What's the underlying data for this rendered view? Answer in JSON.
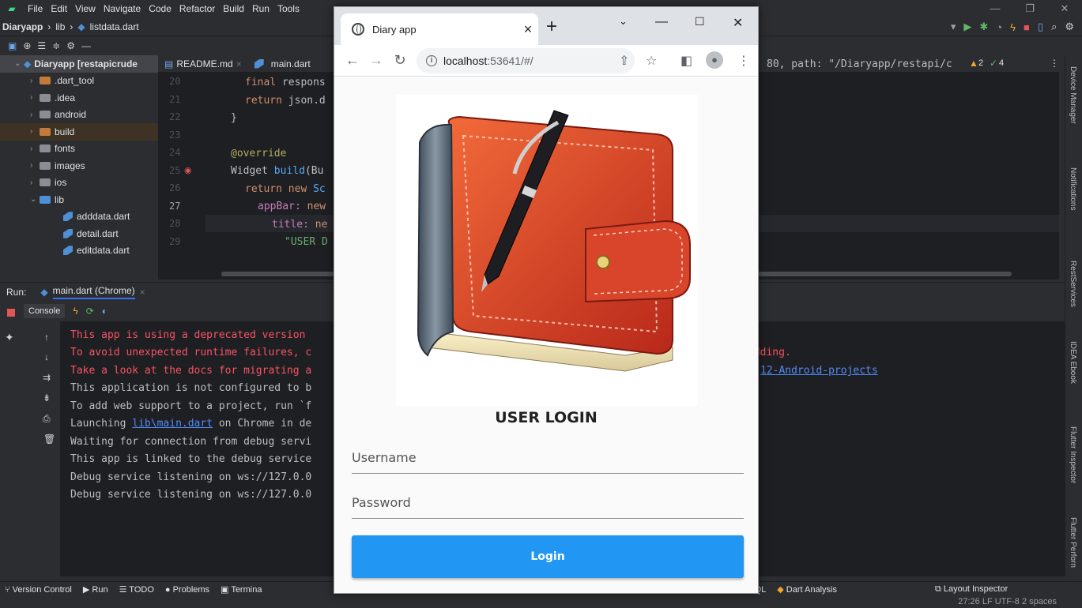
{
  "ide": {
    "menu": [
      "File",
      "Edit",
      "View",
      "Navigate",
      "Code",
      "Refactor",
      "Build",
      "Run",
      "Tools"
    ],
    "breadcrumb": {
      "project": "Diaryapp",
      "folder": "lib",
      "file": "listdata.dart"
    },
    "project_tree": [
      {
        "label": "Diaryapp [restapicrude",
        "type": "root"
      },
      {
        "label": ".dart_tool",
        "type": "folder-orange"
      },
      {
        "label": ".idea",
        "type": "folder"
      },
      {
        "label": "android",
        "type": "folder"
      },
      {
        "label": "build",
        "type": "folder-orange"
      },
      {
        "label": "fonts",
        "type": "folder"
      },
      {
        "label": "images",
        "type": "folder"
      },
      {
        "label": "ios",
        "type": "folder"
      },
      {
        "label": "lib",
        "type": "folder-blue"
      },
      {
        "label": "adddata.dart",
        "type": "dart"
      },
      {
        "label": "detail.dart",
        "type": "dart"
      },
      {
        "label": "editdata.dart",
        "type": "dart"
      }
    ],
    "editor_tabs": [
      "README.md",
      "main.dart"
    ],
    "line_numbers": [
      "20",
      "21",
      "22",
      "23",
      "24",
      "25",
      "26",
      "27",
      "28",
      "29"
    ],
    "code": {
      "l20a": "final ",
      "l20b": "respons",
      "l21a": "return ",
      "l21b": "json.d",
      "l22": "}",
      "l24": "@override",
      "l25a": "Widget ",
      "l25b": "build",
      "l25c": "(Bu",
      "l26a": "return new ",
      "l26b": "Sc",
      "l27a": "appBar: ",
      "l27b": "new",
      "l28a": "title: ",
      "l28b": "ne",
      "l29": "\"USER D",
      "right_snippet": "80, path: \"/Diaryapp/restapi/c"
    },
    "inspections": {
      "warnings": "2",
      "checks": "4"
    },
    "run_panel": {
      "label": "Run:",
      "config": "main.dart (Chrome)",
      "console_tab": "Console"
    },
    "console_lines": [
      {
        "text": "This app is using a deprecated version",
        "tail": "",
        "color": "red"
      },
      {
        "text": "To avoid unexpected runtime failures, c",
        "tail": "edding.",
        "color": "red"
      },
      {
        "text": "Take a look at the docs for migrating a",
        "tail": "12-Android-projects",
        "color": "red"
      },
      {
        "text": "This application is not configured to b",
        "tail": "",
        "color": "normal"
      },
      {
        "text": "To add web support to a project, run `f",
        "tail": "",
        "color": "normal"
      },
      {
        "text": "Launching ",
        "link": "lib\\main.dart",
        "rest": " on Chrome in de",
        "color": "normal"
      },
      {
        "text": "Waiting for connection from debug servi",
        "tail": "",
        "color": "normal"
      },
      {
        "text": "This app is linked to the debug service",
        "tail": "",
        "color": "normal"
      },
      {
        "text": "Debug service listening on ws://127.0.0",
        "tail": "",
        "color": "normal"
      },
      {
        "text": "Debug service listening on ws://127.0.0",
        "tail": "",
        "color": "normal"
      }
    ],
    "right_strip": [
      "Device Manager",
      "Notifications",
      "RestServices",
      "IDEA Ebook",
      "Flutter Inspector",
      "Flutter Perforn"
    ],
    "tool_windows": [
      "Version Control",
      "Run",
      "TODO",
      "Problems",
      "Termina",
      "JPA SQL",
      "Dart Analysis",
      "Layout Inspector"
    ],
    "status": "27:26  LF  UTF-8  2 spaces"
  },
  "browser": {
    "tab_title": "Diary app",
    "url_host": "localhost",
    "url_rest": ":53641/#/",
    "app": {
      "heading": "USER LOGIN",
      "username_label": "Username",
      "password_label": "Password",
      "login_button": "Login"
    }
  },
  "colors": {
    "accent": "#2196f3",
    "ide_bg": "#2b2d30",
    "console_red": "#f75464"
  }
}
